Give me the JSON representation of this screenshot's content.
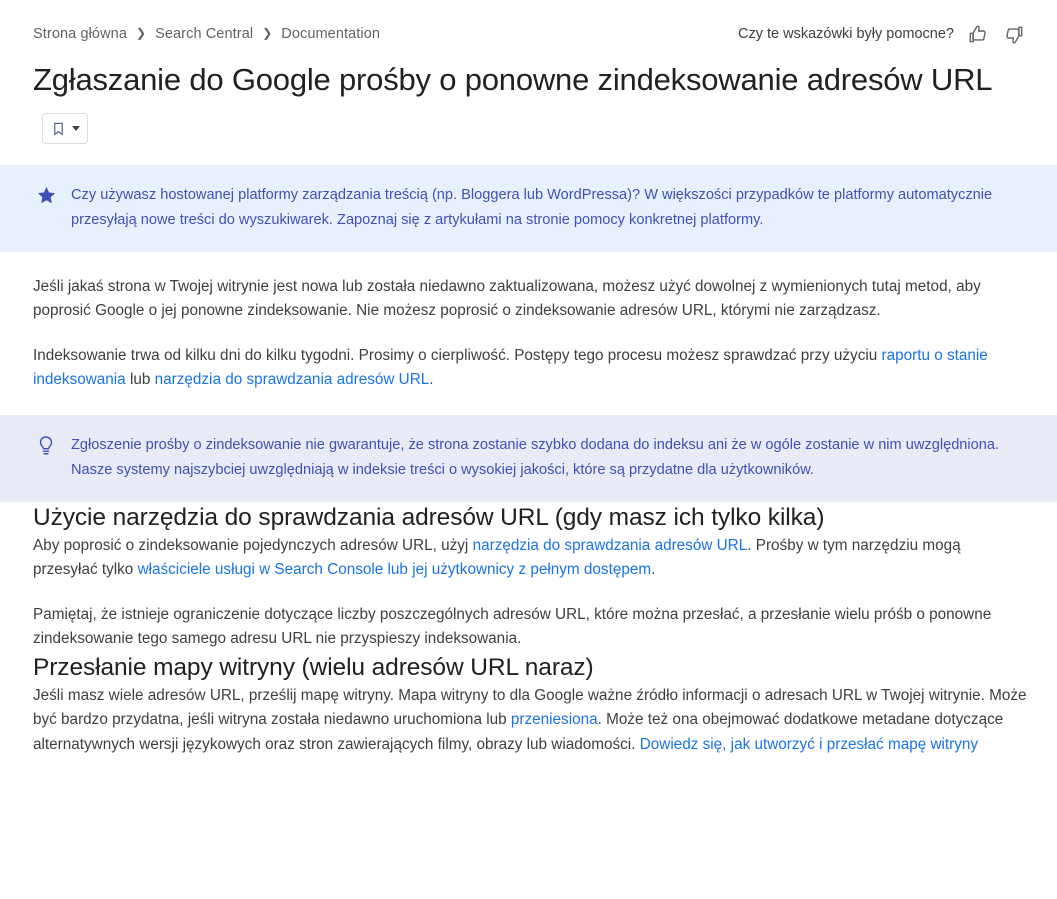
{
  "breadcrumb": {
    "items": [
      {
        "label": "Strona główna"
      },
      {
        "label": "Search Central"
      },
      {
        "label": "Documentation"
      }
    ],
    "separator": "❯"
  },
  "feedback": {
    "label": "Czy te wskazówki były pomocne?",
    "thumb_up_icon": "thumb-up-icon",
    "thumb_down_icon": "thumb-down-icon"
  },
  "page": {
    "title": "Zgłaszanie do Google prośby o ponowne zindeksowanie adresów URL",
    "bookmark_icon": "bookmark-icon",
    "bookmark_caret_icon": "chevron-down-icon"
  },
  "callouts": [
    {
      "icon": "star-icon",
      "type": "note",
      "background": "#e8f0fe",
      "text_color": "#3f51b5",
      "text": "Czy używasz hostowanej platformy zarządzania treścią (np. Bloggera lub WordPressa)? W większości przypadków te platformy automatycznie przesyłają nowe treści do wyszukiwarek. Zapoznaj się z artykułami na stronie pomocy konkretnej platformy."
    },
    {
      "icon": "lightbulb-icon",
      "type": "tip",
      "background": "#e8eaf6",
      "text_color": "#3f51b5",
      "text": "Zgłoszenie prośby o zindeksowanie nie gwarantuje, że strona zostanie szybko dodana do indeksu ani że w ogóle zostanie w nim uwzględniona. Nasze systemy najszybciej uwzględniają w indeksie treści o wysokiej jakości, które są przydatne dla użytkowników."
    }
  ],
  "intro": {
    "paragraph_1": "Jeśli jakaś strona w Twojej witrynie jest nowa lub została niedawno zaktualizowana, możesz użyć dowolnej z wymienionych tutaj metod, aby poprosić Google o jej ponowne zindeksowanie. Nie możesz poprosić o zindeksowanie adresów URL, którymi nie zarządzasz.",
    "paragraph_2_pre": "Indeksowanie trwa od kilku dni do kilku tygodni. Prosimy o cierpliwość. Postępy tego procesu możesz sprawdzać przy użyciu ",
    "paragraph_2_link_1": "raportu o stanie indeksowania",
    "paragraph_2_mid": " lub ",
    "paragraph_2_link_2": "narzędzia do sprawdzania adresów URL",
    "paragraph_2_post": "."
  },
  "sections": [
    {
      "heading": "Użycie narzędzia do sprawdzania adresów URL (gdy masz ich tylko kilka)",
      "paragraph_1_pre": "Aby poprosić o zindeksowanie pojedynczych adresów URL, użyj ",
      "paragraph_1_link_1": "narzędzia do sprawdzania adresów URL",
      "paragraph_1_mid": ". Prośby w tym narzędziu mogą przesyłać tylko ",
      "paragraph_1_link_2": "właściciele usługi w Search Console lub jej użytkownicy z pełnym dostępem",
      "paragraph_1_post": ".",
      "paragraph_2": "Pamiętaj, że istnieje ograniczenie dotyczące liczby poszczególnych adresów URL, które można przesłać, a przesłanie wielu próśb o ponowne zindeksowanie tego samego adresu URL nie przyspieszy indeksowania."
    },
    {
      "heading": "Przesłanie mapy witryny (wielu adresów URL naraz)",
      "paragraph_1_pre": "Jeśli masz wiele adresów URL, prześlij mapę witryny. Mapa witryny to dla Google ważne źródło informacji o adresach URL w Twojej witrynie. Może być bardzo przydatna, jeśli witryna została niedawno uruchomiona lub ",
      "paragraph_1_link_1": "przeniesiona",
      "paragraph_1_mid": ". Może też ona obejmować dodatkowe metadane dotyczące alternatywnych wersji językowych oraz stron zawierających filmy, obrazy lub wiadomości. ",
      "paragraph_1_link_2": "Dowiedz się, jak utworzyć i przesłać mapę witryny",
      "paragraph_1_post": ""
    }
  ],
  "colors": {
    "link": "#1a73e8",
    "heading": "#202124",
    "body": "#3c4043",
    "breadcrumb": "#5f6368",
    "callout_accent": "#3f51b5"
  }
}
